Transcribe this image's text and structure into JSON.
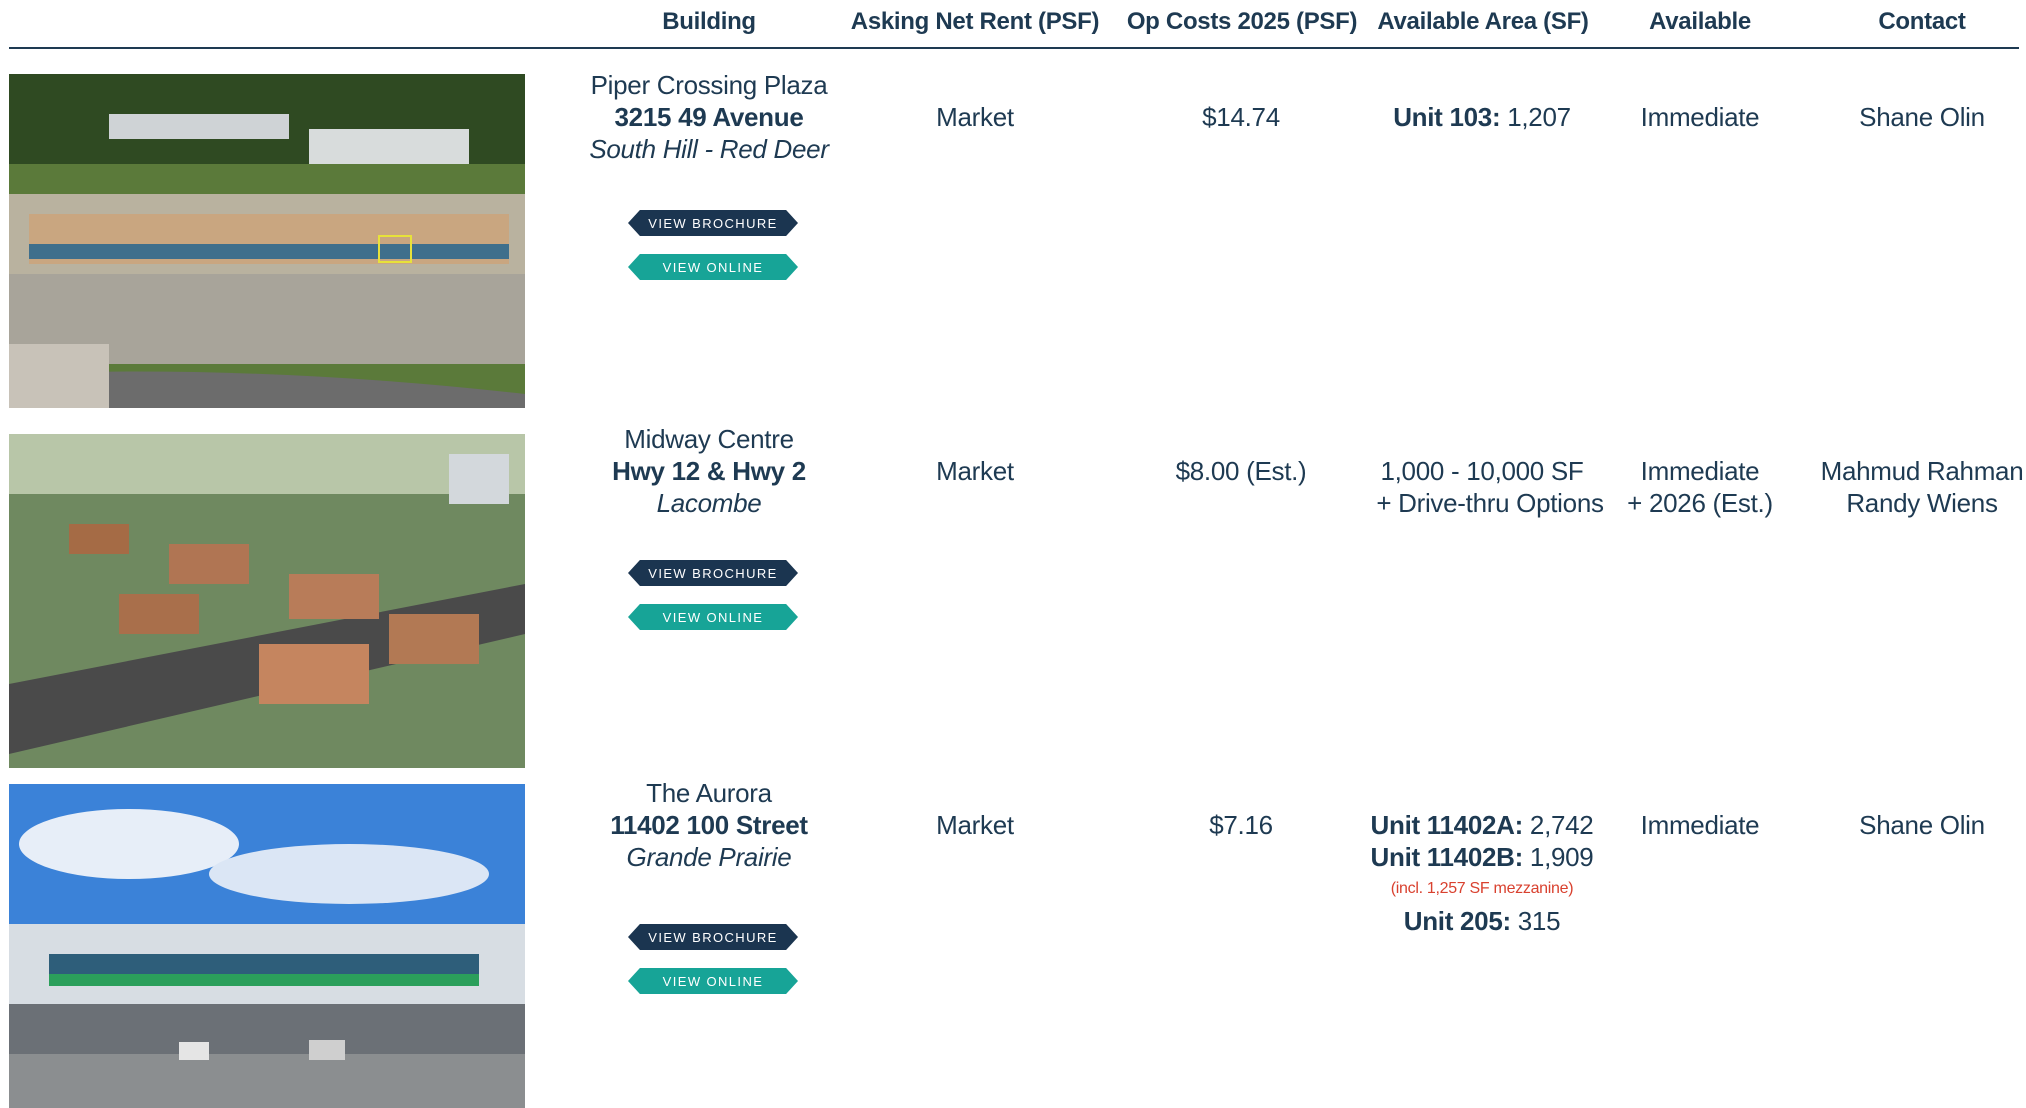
{
  "headers": {
    "building": "Building",
    "rent": "Asking Net Rent (PSF)",
    "opcost": "Op Costs 2025 (PSF)",
    "area": "Available Area (SF)",
    "available": "Available",
    "contact": "Contact"
  },
  "buttons": {
    "brochure": "VIEW BROCHURE",
    "online": "VIEW ONLINE"
  },
  "rows": [
    {
      "name": "Piper Crossing Plaza",
      "address": "3215 49 Avenue",
      "city": "South Hill - Red Deer",
      "rent": "Market",
      "opcost": "$14.74",
      "area": [
        {
          "label": "Unit 103:",
          "value": " 1,207"
        }
      ],
      "available": [
        "Immediate"
      ],
      "contact": [
        "Shane Olin"
      ]
    },
    {
      "name": "Midway Centre",
      "address": "Hwy 12 & Hwy 2",
      "city": "Lacombe",
      "rent": "Market",
      "opcost": "$8.00 (Est.)",
      "area_lines": [
        "1,000 - 10,000 SF",
        "+ Drive-thru Options"
      ],
      "available": [
        "Immediate",
        "+ 2026 (Est.)"
      ],
      "contact": [
        "Mahmud Rahman",
        "Randy Wiens"
      ]
    },
    {
      "name": "The Aurora",
      "address": "11402 100 Street",
      "city": "Grande Prairie",
      "rent": "Market",
      "opcost": "$7.16",
      "area": [
        {
          "label": "Unit 11402A:",
          "value": " 2,742"
        },
        {
          "label": "Unit 11402B:",
          "value": " 1,909"
        },
        {
          "label": "Unit 205:",
          "value": " 315"
        }
      ],
      "area_note": "(incl. 1,257 SF mezzanine)",
      "available": [
        "Immediate"
      ],
      "contact": [
        "Shane Olin"
      ]
    }
  ],
  "colors": {
    "navy": "#1e3a52",
    "teal": "#17a497",
    "note_red": "#d9412f"
  }
}
